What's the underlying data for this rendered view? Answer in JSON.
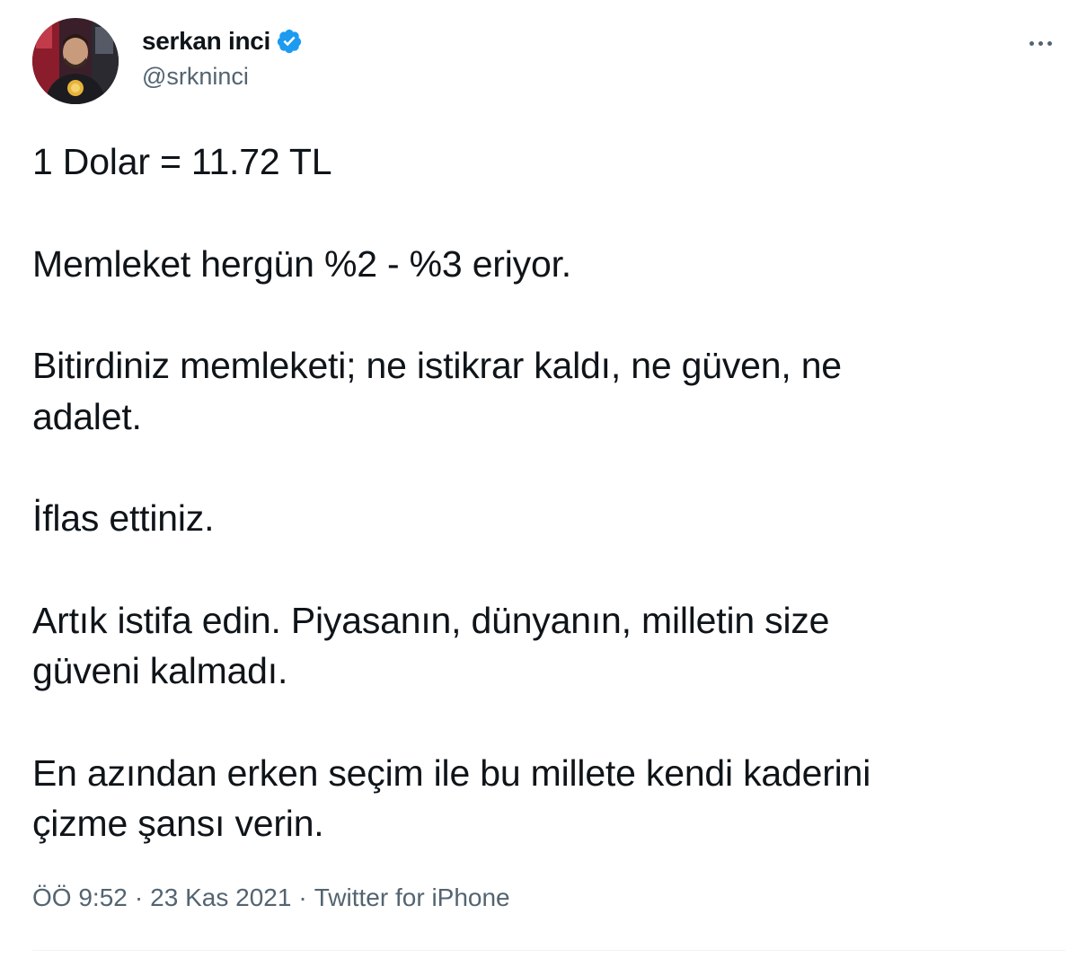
{
  "author": {
    "display_name": "serkan inci",
    "handle": "@srkninci",
    "verified": true
  },
  "icons": {
    "verified": "verified-badge-icon",
    "more": "more-options-icon"
  },
  "tweet": {
    "paragraphs": [
      {
        "lines": [
          "1 Dolar = 11.72 TL"
        ]
      },
      {
        "lines": [
          "Memleket hergün %2 - %3 eriyor."
        ]
      },
      {
        "lines": [
          "Bitirdiniz memleketi; ne istikrar kaldı, ne güven, ne",
          "adalet."
        ]
      },
      {
        "lines": [
          "İflas ettiniz."
        ]
      },
      {
        "lines": [
          "Artık istifa edin. Piyasanın, dünyanın, milletin size",
          "güveni kalmadı."
        ]
      },
      {
        "lines": [
          "En azından erken seçim ile bu millete kendi kaderini",
          "çizme şansı verin."
        ]
      }
    ]
  },
  "meta": {
    "time": "ÖÖ 9:52",
    "date": "23 Kas 2021",
    "separator": "·",
    "source": "Twitter for iPhone"
  },
  "colors": {
    "text": "#0f1419",
    "secondary": "#536471",
    "verified_blue": "#1d9bf0",
    "divider": "#eff3f4"
  }
}
